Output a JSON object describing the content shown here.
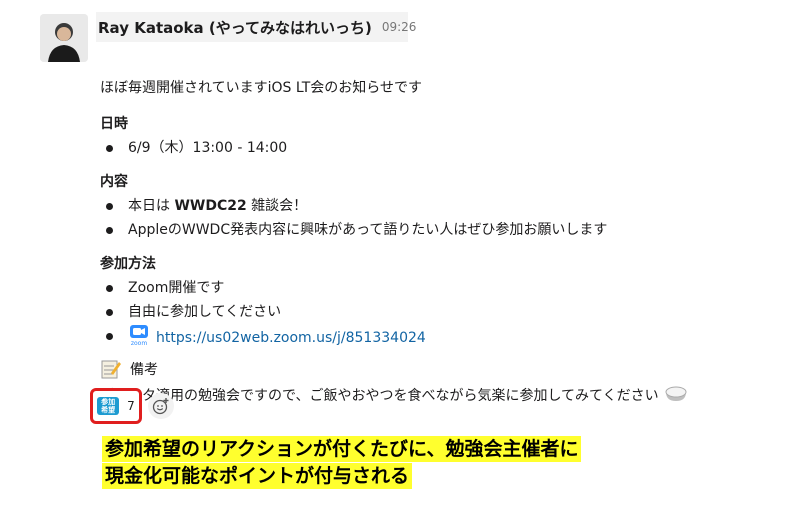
{
  "message": {
    "author": "Ray Kataoka (やってみなはれいっち)",
    "time": "09:26",
    "intro": "ほぼ毎週開催されていますiOS LT会のお知らせです",
    "sections": {
      "datetime": {
        "heading": "日時",
        "items": [
          "6/9（木）13:00 - 14:00"
        ]
      },
      "content": {
        "heading": "内容",
        "item1_prefix": "本日は ",
        "item1_bold": "WWDC22",
        "item1_suffix": " 雑談会！",
        "item2": "AppleのWWDC発表内容に興味があって語りたい人はぜひ参加お願いします"
      },
      "join": {
        "heading": "参加方法",
        "item1": "Zoom開催です",
        "item2": "自由に参加してください",
        "zoom_label": "zoom",
        "link": "https://us02web.zoom.us/j/851334024"
      }
    },
    "memo": {
      "heading": "備考",
      "text": "ぱくスタ適用の勉強会ですので、ご飯やおやつを食べながら気楽に参加してみてください"
    },
    "reaction": {
      "emoji_line1": "参加",
      "emoji_line2": "希望",
      "count": "7"
    }
  },
  "annotation": {
    "line1": "参加希望のリアクションが付くたびに、勉強会主催者に",
    "line2": "現金化可能なポイントが付与される"
  },
  "colors": {
    "link": "#1264a3",
    "highlight": "#ffff2e",
    "reaction_border": "#e01e1e",
    "badge": "#1d9bd1"
  }
}
